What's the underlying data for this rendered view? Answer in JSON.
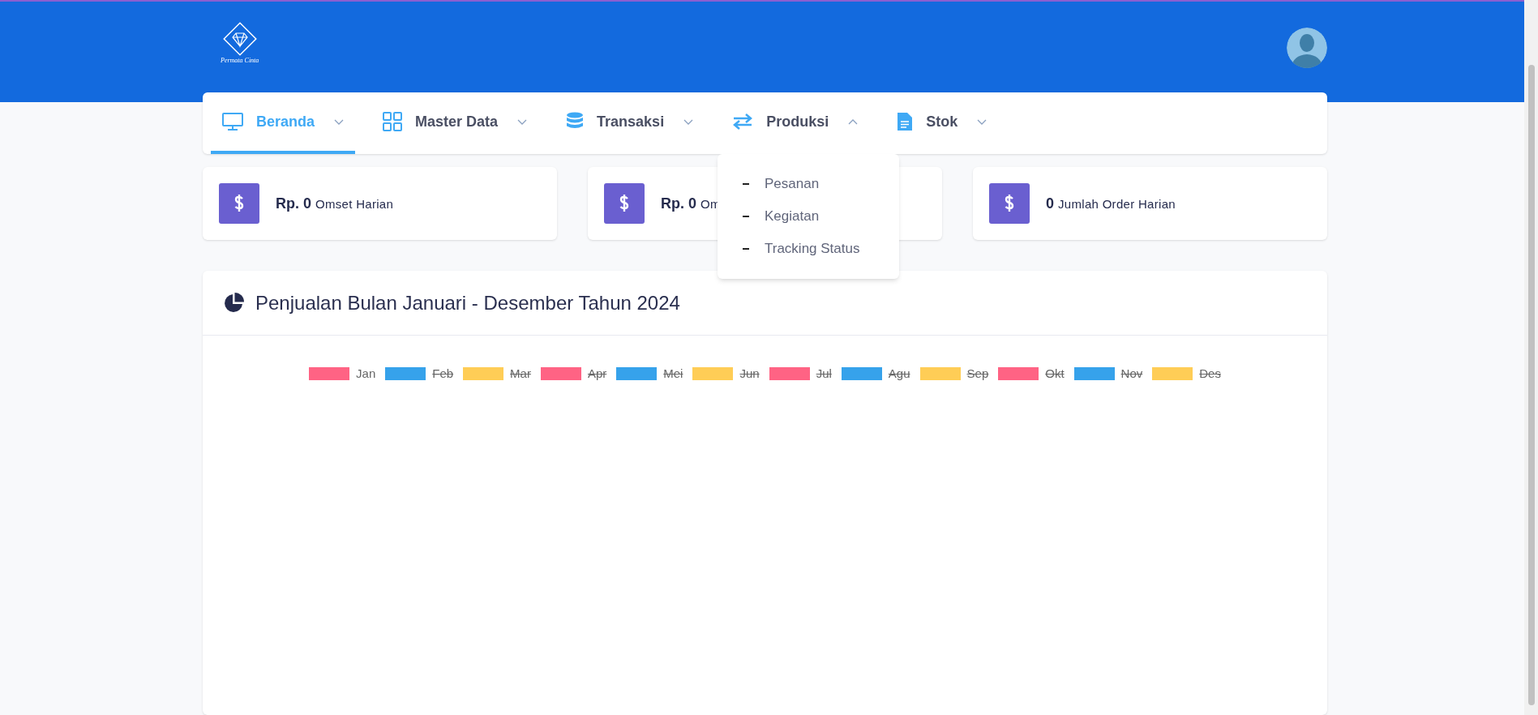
{
  "header": {
    "logo_text": "Permata Cinta"
  },
  "nav": [
    {
      "label": "Beranda",
      "selected": true,
      "expanded": false
    },
    {
      "label": "Master Data",
      "selected": false,
      "expanded": false
    },
    {
      "label": "Transaksi",
      "selected": false,
      "expanded": false
    },
    {
      "label": "Produksi",
      "selected": false,
      "expanded": true
    },
    {
      "label": "Stok",
      "selected": false,
      "expanded": false
    }
  ],
  "dropdown": [
    "Pesanan",
    "Kegiatan",
    "Tracking Status"
  ],
  "cards": [
    {
      "value": "Rp. 0",
      "label": "Omset Harian"
    },
    {
      "value": "Rp. 0",
      "label": "Om"
    },
    {
      "value": "0",
      "label": "Jumlah Order Harian"
    }
  ],
  "chart_card": {
    "title": "Penjualan Bulan Januari - Desember Tahun 2024",
    "legend": [
      {
        "label": "Jan",
        "color": "#ff6384",
        "hidden": false
      },
      {
        "label": "Feb",
        "color": "#36a2eb",
        "hidden": true
      },
      {
        "label": "Mar",
        "color": "#ffcd56",
        "hidden": true
      },
      {
        "label": "Apr",
        "color": "#ff6384",
        "hidden": true
      },
      {
        "label": "Mei",
        "color": "#36a2eb",
        "hidden": true
      },
      {
        "label": "Jun",
        "color": "#ffcd56",
        "hidden": true
      },
      {
        "label": "Jul",
        "color": "#ff6384",
        "hidden": true
      },
      {
        "label": "Agu",
        "color": "#36a2eb",
        "hidden": true
      },
      {
        "label": "Sep",
        "color": "#ffcd56",
        "hidden": true
      },
      {
        "label": "Okt",
        "color": "#ff6384",
        "hidden": true
      },
      {
        "label": "Nov",
        "color": "#36a2eb",
        "hidden": true
      },
      {
        "label": "Des",
        "color": "#ffcd56",
        "hidden": true
      }
    ]
  }
}
